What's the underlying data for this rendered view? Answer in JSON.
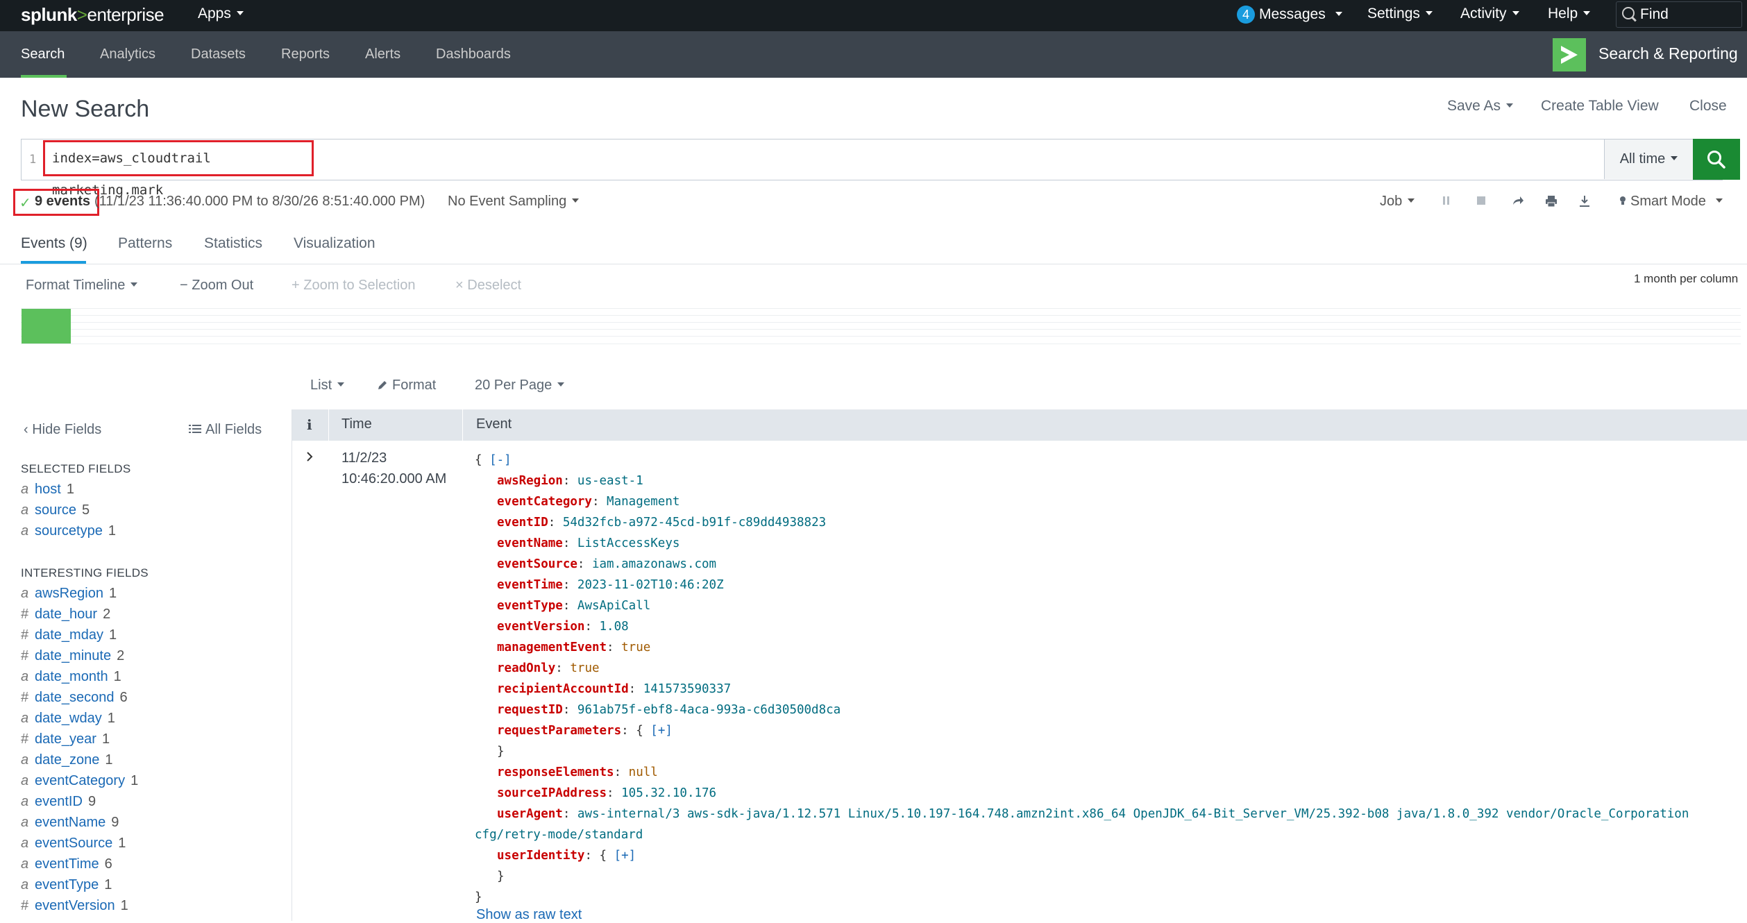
{
  "topbar": {
    "logo_brand": "splunk",
    "logo_sep": ">",
    "logo_product": "enterprise",
    "apps": "Apps",
    "messages_count": "4",
    "messages": "Messages",
    "settings": "Settings",
    "activity": "Activity",
    "help": "Help",
    "find": "Find"
  },
  "appbar": {
    "nav": [
      "Search",
      "Analytics",
      "Datasets",
      "Reports",
      "Alerts",
      "Dashboards"
    ],
    "app_title": "Search & Reporting"
  },
  "page": {
    "title": "New Search",
    "save_as": "Save As",
    "create_table_view": "Create Table View",
    "close": "Close"
  },
  "search": {
    "line_number": "1",
    "query": "index=aws_cloudtrail marketing.mark",
    "time_range": "All time"
  },
  "status": {
    "events_count": "9 events",
    "range": "(11/1/23 11:36:40.000 PM to 8/30/26 8:51:40.000 PM)",
    "sampling": "No Event Sampling",
    "job": "Job",
    "mode": "Smart Mode"
  },
  "tabs": [
    "Events (9)",
    "Patterns",
    "Statistics",
    "Visualization"
  ],
  "timeline": {
    "format": "Format Timeline",
    "zoom_out": "Zoom Out",
    "zoom_selection": "Zoom to Selection",
    "deselect": "Deselect",
    "per_column": "1 month per column"
  },
  "list_controls": {
    "view": "List",
    "format": "Format",
    "per_page": "20 Per Page"
  },
  "sidebar": {
    "hide_fields": "Hide Fields",
    "all_fields": "All Fields",
    "selected_heading": "SELECTED FIELDS",
    "selected": [
      {
        "type": "a",
        "name": "host",
        "count": "1"
      },
      {
        "type": "a",
        "name": "source",
        "count": "5"
      },
      {
        "type": "a",
        "name": "sourcetype",
        "count": "1"
      }
    ],
    "interesting_heading": "INTERESTING FIELDS",
    "interesting": [
      {
        "type": "a",
        "name": "awsRegion",
        "count": "1"
      },
      {
        "type": "#",
        "name": "date_hour",
        "count": "2"
      },
      {
        "type": "#",
        "name": "date_mday",
        "count": "1"
      },
      {
        "type": "#",
        "name": "date_minute",
        "count": "2"
      },
      {
        "type": "a",
        "name": "date_month",
        "count": "1"
      },
      {
        "type": "#",
        "name": "date_second",
        "count": "6"
      },
      {
        "type": "a",
        "name": "date_wday",
        "count": "1"
      },
      {
        "type": "#",
        "name": "date_year",
        "count": "1"
      },
      {
        "type": "a",
        "name": "date_zone",
        "count": "1"
      },
      {
        "type": "a",
        "name": "eventCategory",
        "count": "1"
      },
      {
        "type": "a",
        "name": "eventID",
        "count": "9"
      },
      {
        "type": "a",
        "name": "eventName",
        "count": "9"
      },
      {
        "type": "a",
        "name": "eventSource",
        "count": "1"
      },
      {
        "type": "a",
        "name": "eventTime",
        "count": "6"
      },
      {
        "type": "a",
        "name": "eventType",
        "count": "1"
      },
      {
        "type": "#",
        "name": "eventVersion",
        "count": "1"
      }
    ]
  },
  "table": {
    "col_info": "i",
    "col_time": "Time",
    "col_event": "Event"
  },
  "event": {
    "date": "11/2/23",
    "time": "10:46:20.000 AM",
    "open_brace": "{",
    "collapse": "[-]",
    "fields": [
      {
        "key": "awsRegion",
        "value": "us-east-1",
        "kind": "s"
      },
      {
        "key": "eventCategory",
        "value": "Management",
        "kind": "s"
      },
      {
        "key": "eventID",
        "value": "54d32fcb-a972-45cd-b91f-c89dd4938823",
        "kind": "s"
      },
      {
        "key": "eventName",
        "value": "ListAccessKeys",
        "kind": "s"
      },
      {
        "key": "eventSource",
        "value": "iam.amazonaws.com",
        "kind": "s"
      },
      {
        "key": "eventTime",
        "value": "2023-11-02T10:46:20Z",
        "kind": "s"
      },
      {
        "key": "eventType",
        "value": "AwsApiCall",
        "kind": "s"
      },
      {
        "key": "eventVersion",
        "value": "1.08",
        "kind": "s"
      },
      {
        "key": "managementEvent",
        "value": "true",
        "kind": "b"
      },
      {
        "key": "readOnly",
        "value": "true",
        "kind": "b"
      },
      {
        "key": "recipientAccountId",
        "value": "141573590337",
        "kind": "s"
      },
      {
        "key": "requestID",
        "value": "961ab75f-ebf8-4aca-993a-c6d30500d8ca",
        "kind": "s"
      },
      {
        "key": "requestParameters",
        "value": "[+]",
        "kind": "o"
      },
      {
        "key": "responseElements",
        "value": "null",
        "kind": "b"
      },
      {
        "key": "sourceIPAddress",
        "value": "105.32.10.176",
        "kind": "s"
      },
      {
        "key": "userAgent",
        "value": "aws-internal/3 aws-sdk-java/1.12.571 Linux/5.10.197-164.748.amzn2int.x86_64 OpenJDK_64-Bit_Server_VM/25.392-b08 java/1.8.0_392 vendor/Oracle_Corporation",
        "cont": "cfg/retry-mode/standard",
        "kind": "s"
      },
      {
        "key": "userIdentity",
        "value": "[+]",
        "kind": "o"
      }
    ],
    "close_brace": "}",
    "show_raw": "Show as raw text"
  },
  "colors": {
    "topbar_bg": "#171d21",
    "appbar_bg": "#3c444d",
    "accent_green": "#5cc05c",
    "search_btn": "#1a8a33",
    "link_blue": "#1a69b5",
    "highlight_red": "#e0202a"
  }
}
